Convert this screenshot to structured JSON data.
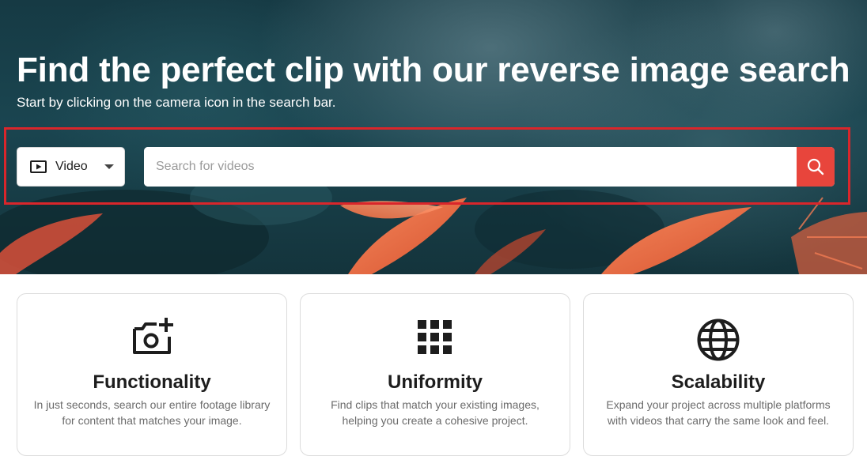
{
  "hero": {
    "title": "Find the perfect clip with our reverse image search",
    "subtitle": "Start by clicking on the camera icon in the search bar."
  },
  "search": {
    "type_selected": "Video",
    "type_icon": "video-play-icon",
    "placeholder": "Search for videos",
    "value": "",
    "button_icon": "search-icon"
  },
  "colors": {
    "accent": "#e8453c",
    "highlight_border": "#d9262b",
    "hero_bg": "#163a44"
  },
  "features": [
    {
      "icon": "camera-plus-icon",
      "title": "Functionality",
      "desc_line1": "In just seconds, search our entire footage library",
      "desc_line2": "for content that matches your image."
    },
    {
      "icon": "grid-icon",
      "title": "Uniformity",
      "desc_line1": "Find clips that match your existing images,",
      "desc_line2": "helping you create a cohesive project."
    },
    {
      "icon": "globe-icon",
      "title": "Scalability",
      "desc_line1": "Expand your project across multiple platforms",
      "desc_line2": "with videos that carry the same look and feel."
    }
  ]
}
